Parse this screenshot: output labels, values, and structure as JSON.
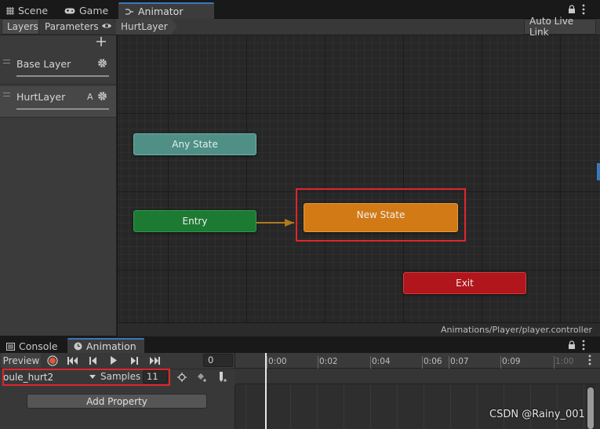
{
  "window_tabs": [
    {
      "label": "Scene",
      "icon": "grid-icon"
    },
    {
      "label": "Game",
      "icon": "gamepad-icon"
    },
    {
      "label": "Animator",
      "icon": "animator-icon"
    }
  ],
  "toolbar": {
    "layers_label": "Layers",
    "parameters_label": "Parameters",
    "breadcrumb": "HurtLayer",
    "auto_live_link": "Auto Live Link"
  },
  "layers": [
    {
      "name": "Base Layer",
      "badge": ""
    },
    {
      "name": "HurtLayer",
      "badge": "A"
    }
  ],
  "states": {
    "any_state": "Any State",
    "entry": "Entry",
    "new_state": "New State",
    "exit": "Exit"
  },
  "colors": {
    "any_state": "#4f8f86",
    "entry": "#1c7a32",
    "new_state": "#d27a16",
    "exit": "#b0161c",
    "highlight": "#e0252b",
    "accent": "#3a79bb"
  },
  "controller_path": "Animations/Player/player.controller",
  "bottom_tabs": [
    {
      "label": "Console",
      "icon": "console-icon"
    },
    {
      "label": "Animation",
      "icon": "clock-icon"
    }
  ],
  "animation": {
    "preview_label": "Preview",
    "frame": "0",
    "clip": "oule_hurt2",
    "samples_label": "Samples",
    "samples": "11",
    "add_property": "Add Property",
    "timeline_ticks": [
      "0:00",
      "0:02",
      "0:04",
      "0:06",
      "0:07",
      "0:09",
      "1:00"
    ]
  },
  "watermark": "CSDN @Rainy_001"
}
